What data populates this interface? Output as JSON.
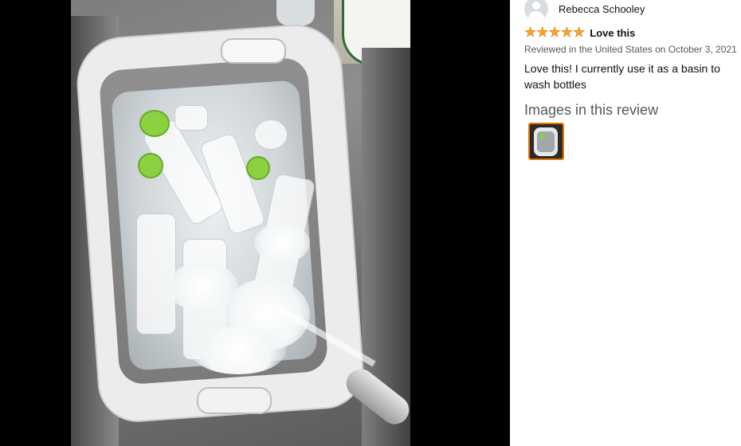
{
  "reviewer": {
    "name": "Rebecca Schooley",
    "avatar_icon": "default-profile-icon"
  },
  "review": {
    "rating": 5,
    "max_rating": 5,
    "star_icon": "star-filled-icon",
    "star_glyph": "★",
    "title": "Love this",
    "date_line": "Reviewed in the United States on October 3, 2021",
    "body": "Love this! I currently use it as a basin to wash bottles"
  },
  "images_section": {
    "heading": "Images in this review",
    "thumbnails": [
      {
        "name": "review-image-1",
        "selected": true
      }
    ]
  },
  "colors": {
    "viewer_background": "#000000",
    "star": "#ffa41c",
    "selected_thumb_border": "#e77600",
    "secondary_text": "#565959"
  }
}
